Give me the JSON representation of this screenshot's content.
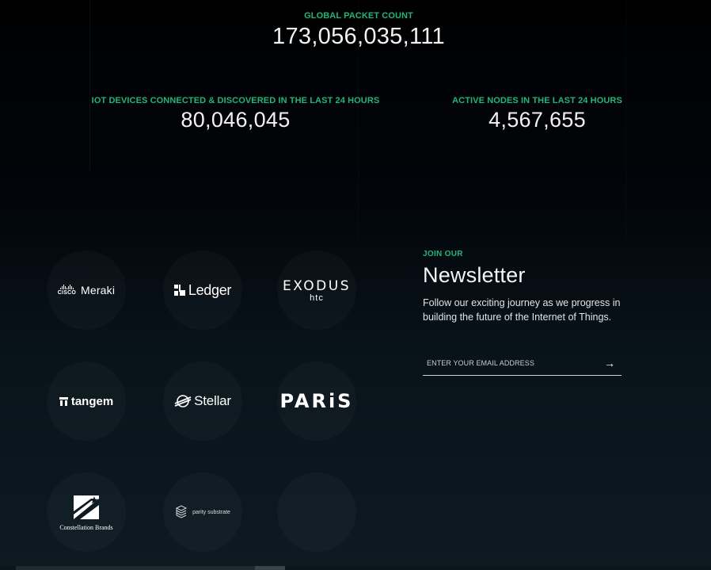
{
  "stats": {
    "global": {
      "label": "GLOBAL PACKET COUNT",
      "value": "173,056,035,111"
    },
    "iot": {
      "label": "IOT DEVICES CONNECTED & DISCOVERED IN THE LAST 24 HOURS",
      "value": "80,046,045"
    },
    "nodes": {
      "label": "ACTIVE NODES IN THE LAST 24 HOURS",
      "value": "4,567,655"
    }
  },
  "partners": {
    "meraki": {
      "cisco": "CISCO",
      "name": "Meraki",
      "icon": "cisco-bars-icon"
    },
    "ledger": {
      "name": "Ledger",
      "icon": "ledger-blocks-icon"
    },
    "exodus": {
      "name": "EXODUS",
      "sub": "htc"
    },
    "tangem": {
      "name": "tangem",
      "icon": "tangem-t-icon"
    },
    "stellar": {
      "name": "Stellar",
      "icon": "stellar-rocket-icon"
    },
    "paris": {
      "name": "PARiS"
    },
    "constellation": {
      "name": "Constellation Brands",
      "icon": "shooting-star-icon"
    },
    "parity": {
      "name": "parity substrate",
      "icon": "parity-cube-icon"
    }
  },
  "newsletter": {
    "eyebrow": "JOIN OUR",
    "title": "Newsletter",
    "description": "Follow our exciting journey as we progress in building the future of the Internet of Things.",
    "email_placeholder": "ENTER YOUR EMAIL ADDRESS",
    "submit_icon": "arrow-right-icon",
    "submit_glyph": "→"
  },
  "colors": {
    "accent": "#22b57a",
    "background_top": "#000000",
    "background_bottom": "#0d1a22"
  }
}
